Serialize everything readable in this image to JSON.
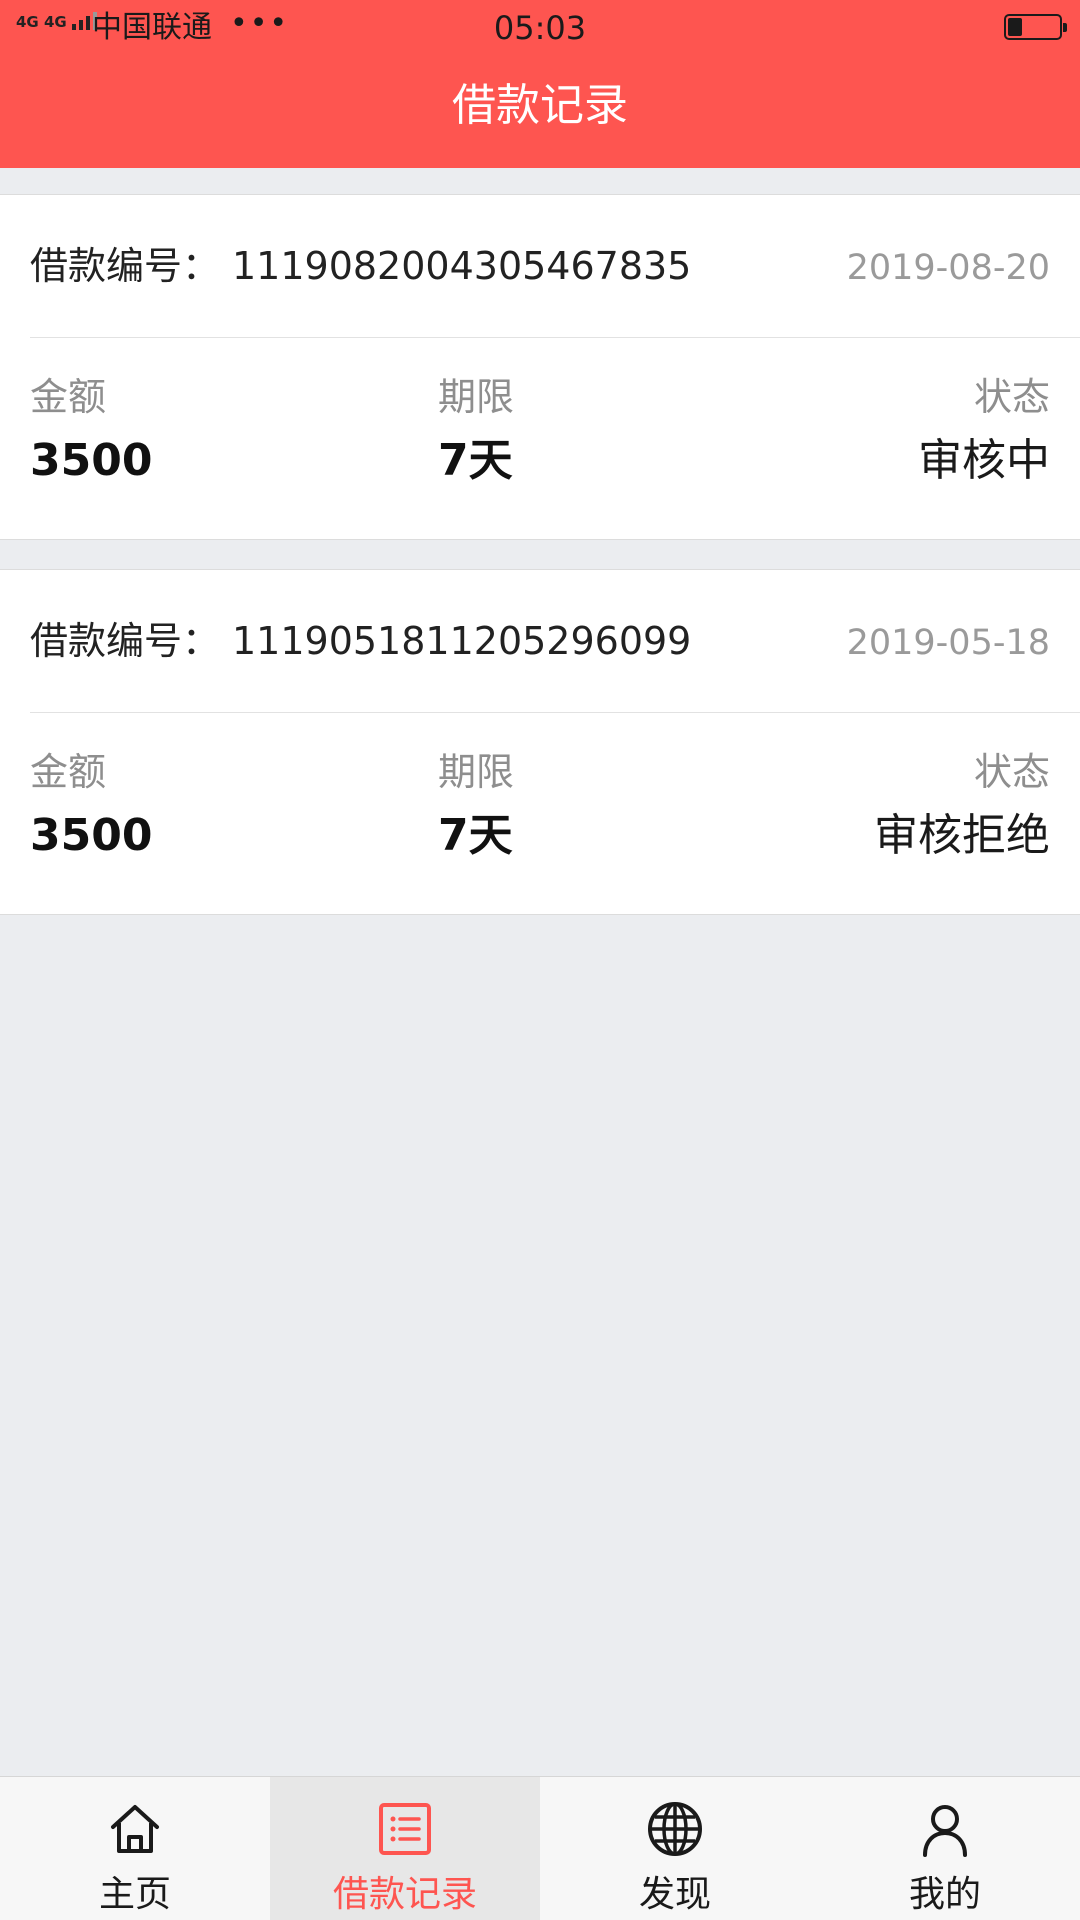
{
  "status_bar": {
    "network": "4G 4G",
    "carrier": "中国联通",
    "more": "•••",
    "time": "05:03"
  },
  "header": {
    "title": "借款记录"
  },
  "loans": [
    {
      "label": "借款编号：",
      "number": "1119082004305467835",
      "date": "2019-08-20",
      "amount_label": "金额",
      "amount": "3500",
      "term_label": "期限",
      "term": "7天",
      "status_label": "状态",
      "status": "审核中"
    },
    {
      "label": "借款编号：",
      "number": "1119051811205296099",
      "date": "2019-05-18",
      "amount_label": "金额",
      "amount": "3500",
      "term_label": "期限",
      "term": "7天",
      "status_label": "状态",
      "status": "审核拒绝"
    }
  ],
  "tabbar": {
    "items": [
      {
        "label": "主页",
        "icon": "home-icon",
        "active": false
      },
      {
        "label": "借款记录",
        "icon": "list-icon",
        "active": true
      },
      {
        "label": "发现",
        "icon": "globe-icon",
        "active": false
      },
      {
        "label": "我的",
        "icon": "user-icon",
        "active": false
      }
    ]
  },
  "colors": {
    "accent": "#fe5550",
    "background": "#ebedf0",
    "muted_text": "#8e8e8e"
  }
}
